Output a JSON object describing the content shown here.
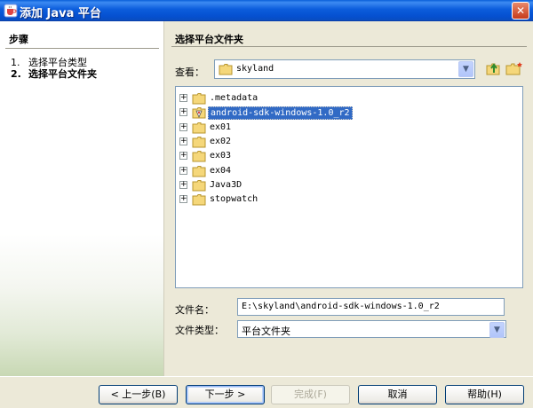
{
  "window": {
    "title": "添加 Java 平台",
    "close_glyph": "✕"
  },
  "steps": {
    "heading": "步骤",
    "items": [
      {
        "num": "1.",
        "label": "选择平台类型"
      },
      {
        "num": "2.",
        "label": "选择平台文件夹"
      }
    ]
  },
  "main": {
    "heading": "选择平台文件夹",
    "look_in_label": "查看：",
    "look_in_value": "skyland",
    "tree": [
      {
        "label": ".metadata",
        "expander": "+",
        "icon": "folder-icon"
      },
      {
        "label": "android-sdk-windows-1.0_r2",
        "expander": "+",
        "icon": "platform-folder-icon",
        "selected": true
      },
      {
        "label": "ex01",
        "expander": "+",
        "icon": "folder-icon"
      },
      {
        "label": "ex02",
        "expander": "+",
        "icon": "folder-icon"
      },
      {
        "label": "ex03",
        "expander": "+",
        "icon": "folder-icon"
      },
      {
        "label": "ex04",
        "expander": "+",
        "icon": "folder-icon"
      },
      {
        "label": "Java3D",
        "expander": "+",
        "icon": "folder-icon"
      },
      {
        "label": "stopwatch",
        "expander": "+",
        "icon": "folder-icon"
      }
    ],
    "file_name_label": "文件名：",
    "file_name_value": "E:\\skyland\\android-sdk-windows-1.0_r2",
    "file_type_label": "文件类型：",
    "file_type_value": "平台文件夹"
  },
  "buttons": {
    "back": "< 上一步(B)",
    "next": "下一步 >",
    "finish": "完成(F)",
    "cancel": "取消",
    "help": "帮助(H)"
  },
  "icons": {
    "combo_arrow": "▼",
    "up_folder": "up-folder-icon",
    "new_folder": "new-folder-icon"
  },
  "colors": {
    "titlebar": "#0C5DDC",
    "selection": "#316AC5",
    "folder": "#F5D77A"
  }
}
